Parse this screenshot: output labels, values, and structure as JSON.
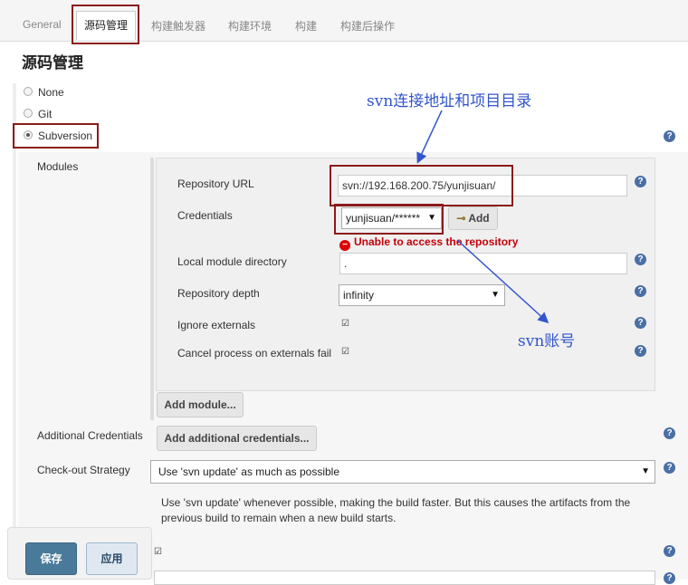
{
  "tabs": [
    "General",
    "源码管理",
    "构建触发器",
    "构建环境",
    "构建",
    "构建后操作"
  ],
  "section_title": "源码管理",
  "scm_options": [
    "None",
    "Git",
    "Subversion"
  ],
  "modules": {
    "label": "Modules",
    "repository_url_label": "Repository URL",
    "repository_url_value": "svn://192.168.200.75/yunjisuan/",
    "credentials_label": "Credentials",
    "credentials_value": "yunjisuan/******",
    "add_button": "Add",
    "error_text": "Unable to access the repository",
    "local_dir_label": "Local module directory",
    "local_dir_value": ".",
    "depth_label": "Repository depth",
    "depth_value": "infinity",
    "ignore_externals_label": "Ignore externals",
    "cancel_process_label": "Cancel process on externals fail",
    "add_module_button": "Add module..."
  },
  "additional_credentials": {
    "label": "Additional Credentials",
    "button": "Add additional credentials..."
  },
  "checkout": {
    "label": "Check-out Strategy",
    "value": "Use 'svn update' as much as possible",
    "description": "Use 'svn update' whenever possible, making the build faster. But this causes the artifacts from the previous build to remain when a new build starts."
  },
  "footer": {
    "save": "保存",
    "apply": "应用"
  },
  "annotations": {
    "svn_url": "svn连接地址和项目目录",
    "svn_account": "svn账号"
  },
  "colors": {
    "annotation": "#3355cc",
    "highlight_box": "#8b1a1a",
    "error": "#c4000a",
    "save_button": "#4a7a99"
  }
}
